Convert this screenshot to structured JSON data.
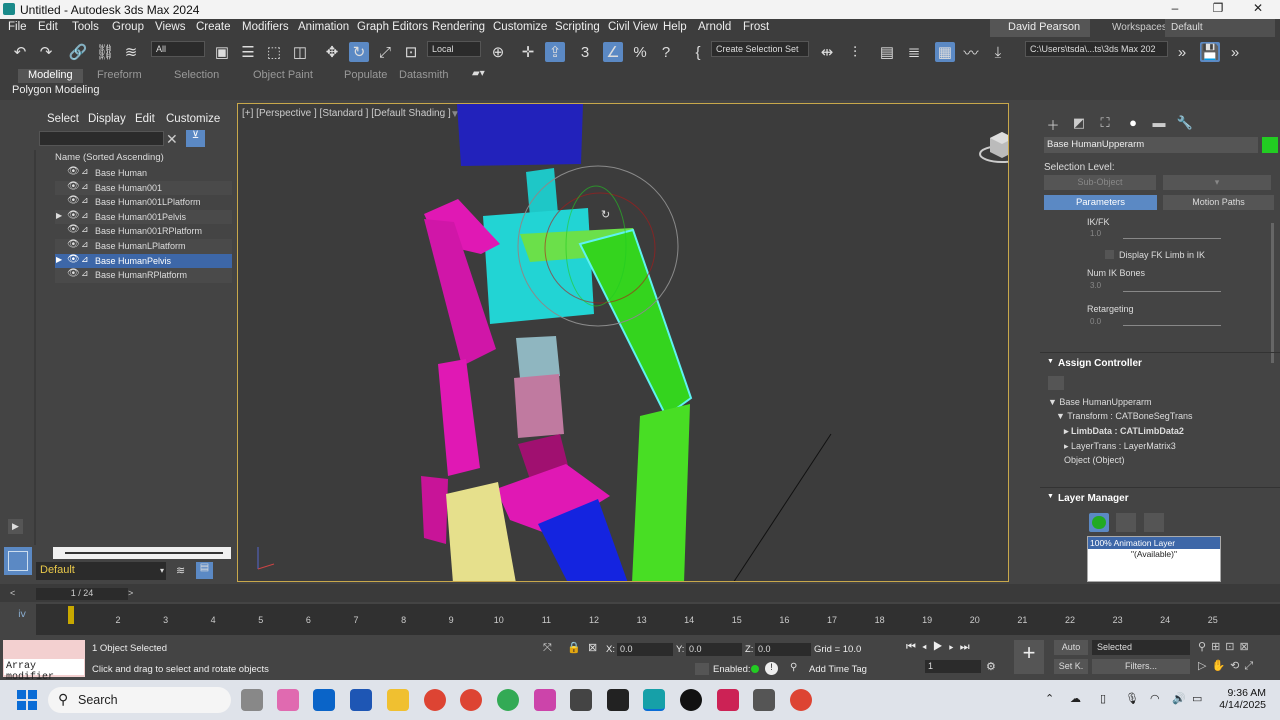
{
  "window": {
    "title": "Untitled - Autodesk 3ds Max 2024",
    "min": "–",
    "max": "❐",
    "close": "✕"
  },
  "menu": [
    "File",
    "Edit",
    "Tools",
    "Group",
    "Views",
    "Create",
    "Modifiers",
    "Animation",
    "Graph Editors",
    "Rendering",
    "Customize",
    "Scripting",
    "Civil View",
    "Help",
    "Arnold",
    "Frost"
  ],
  "user": "David Pearson",
  "workspaces_label": "Workspaces:",
  "workspace": "Default",
  "toolbar": {
    "filter": "All",
    "coord": "Local",
    "selset": "Create Selection Set",
    "path": "C:\\Users\\tsda\\...ts\\3ds Max 202"
  },
  "ribbon": {
    "tabs": [
      "Modeling",
      "Freeform",
      "Selection",
      "Object Paint",
      "Populate",
      "Datasmith"
    ],
    "active": "Modeling",
    "sub": "Polygon Modeling"
  },
  "scene": {
    "tabs": [
      "Select",
      "Display",
      "Edit",
      "Customize"
    ],
    "column": "Name (Sorted Ascending)",
    "rows": [
      {
        "name": "Base Human",
        "exp": ""
      },
      {
        "name": "Base Human001",
        "exp": ""
      },
      {
        "name": "Base Human001LPlatform",
        "exp": ""
      },
      {
        "name": "Base Human001Pelvis",
        "exp": "▶"
      },
      {
        "name": "Base Human001RPlatform",
        "exp": ""
      },
      {
        "name": "Base HumanLPlatform",
        "exp": ""
      },
      {
        "name": "Base HumanPelvis",
        "exp": "▶"
      },
      {
        "name": "Base HumanRPlatform",
        "exp": ""
      }
    ],
    "layer": "Default"
  },
  "viewport": {
    "label": "[+] [Perspective ] [Standard ] [Default Shading ]"
  },
  "cmd": {
    "object": "Base HumanUpperarm",
    "color": "#22cc22",
    "selection_level": "Selection Level:",
    "subobject": "Sub-Object",
    "tabs": [
      "Parameters",
      "Motion Paths"
    ],
    "params": [
      {
        "label": "IK/FK",
        "value": "1.0"
      },
      {
        "label": "Num IK Bones",
        "value": "3.0"
      },
      {
        "label": "Retargeting",
        "value": "0.0"
      }
    ],
    "display_fk": "Display FK Limb in IK",
    "assign_controller": "Assign Controller",
    "tree": [
      "Base HumanUpperarm",
      "Transform : CATBoneSegTrans",
      "LimbData : CATLimbData2",
      "LayerTrans : LayerMatrix3",
      "Object (Object)"
    ],
    "layer_manager": "Layer Manager",
    "anim_layer": "100% Animation Layer",
    "available": "\"(Available)\""
  },
  "time": {
    "slider": "1 / 24",
    "ticks": [
      "2",
      "3",
      "4",
      "5",
      "6",
      "7",
      "8",
      "9",
      "10",
      "11",
      "12",
      "13",
      "14",
      "15",
      "16",
      "17",
      "18",
      "19",
      "20",
      "21",
      "22",
      "23",
      "24",
      "25"
    ]
  },
  "status": {
    "modifier": "Array modifier",
    "selected": "1 Object Selected",
    "hint": "Click and drag to select and rotate objects",
    "x": "0.0",
    "y": "0.0",
    "z": "0.0",
    "grid": "Grid = 10.0",
    "enabled": "Enabled:",
    "addtag": "Add Time Tag",
    "frame": "1",
    "auto": "Auto",
    "setk": "Set K.",
    "selmode": "Selected",
    "filters": "Filters..."
  },
  "taskbar": {
    "search": "Search",
    "time": "9:36 AM",
    "date": "4/14/2025"
  }
}
